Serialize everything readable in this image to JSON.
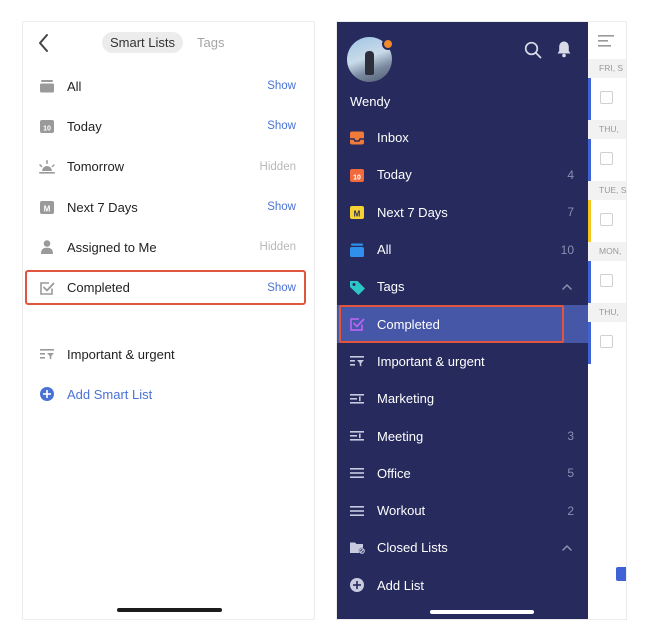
{
  "smart_lists_screen": {
    "tabs": [
      "Smart Lists",
      "Tags"
    ],
    "active_tab": "Smart Lists",
    "items": [
      {
        "label": "All",
        "status": "Show",
        "icon": "stack-icon"
      },
      {
        "label": "Today",
        "status": "Show",
        "icon": "calendar-10-icon"
      },
      {
        "label": "Tomorrow",
        "status": "Hidden",
        "icon": "sunrise-icon"
      },
      {
        "label": "Next 7 Days",
        "status": "Show",
        "icon": "calendar-m-icon"
      },
      {
        "label": "Assigned to Me",
        "status": "Hidden",
        "icon": "person-icon"
      },
      {
        "label": "Completed",
        "status": "Show",
        "icon": "checkbox-icon",
        "highlighted": true
      }
    ],
    "filter_item": {
      "label": "Important & urgent",
      "icon": "filter-list-icon"
    },
    "add_item": {
      "label": "Add Smart List",
      "icon": "plus-circle-icon"
    }
  },
  "sidebar_screen": {
    "username": "Wendy",
    "calendar_day": "10",
    "calendar_letter": "M",
    "nav_items": [
      {
        "label": "Inbox",
        "count": "",
        "icon": "inbox-icon"
      },
      {
        "label": "Today",
        "count": "4",
        "icon": "calendar-10-icon"
      },
      {
        "label": "Next 7 Days",
        "count": "7",
        "icon": "calendar-m-icon"
      },
      {
        "label": "All",
        "count": "10",
        "icon": "stack-icon"
      },
      {
        "label": "Tags",
        "count": "",
        "icon": "tag-icon",
        "expanded": true
      },
      {
        "label": "Completed",
        "count": "",
        "icon": "checkbox-icon",
        "selected": true
      },
      {
        "label": "Important & urgent",
        "count": "",
        "icon": "filter-list-icon"
      },
      {
        "label": "Marketing",
        "count": "",
        "icon": "filter-list-icon"
      },
      {
        "label": "Meeting",
        "count": "3",
        "icon": "filter-list-icon"
      },
      {
        "label": "Office",
        "count": "5",
        "icon": "list-icon"
      },
      {
        "label": "Workout",
        "count": "2",
        "icon": "list-icon"
      },
      {
        "label": "Closed Lists",
        "count": "",
        "icon": "folder-icon",
        "expanded": true
      },
      {
        "label": "Add List",
        "count": "",
        "icon": "plus-circle-icon"
      }
    ],
    "peek_dates": [
      "FRI, S",
      "THU,",
      "TUE, S",
      "MON,",
      "THU,"
    ]
  },
  "colors": {
    "sidebar_bg": "#262a5c",
    "selected_bg": "#4657a8",
    "highlight_border": "#e0553e",
    "accent_blue": "#4a72d6",
    "inbox_orange": "#f07a3a",
    "today_orange": "#f06a3c",
    "next7_yellow": "#f6d232",
    "all_blue": "#2f8fea",
    "tag_teal": "#2cc6c9",
    "completed_purple": "#b464f0"
  }
}
